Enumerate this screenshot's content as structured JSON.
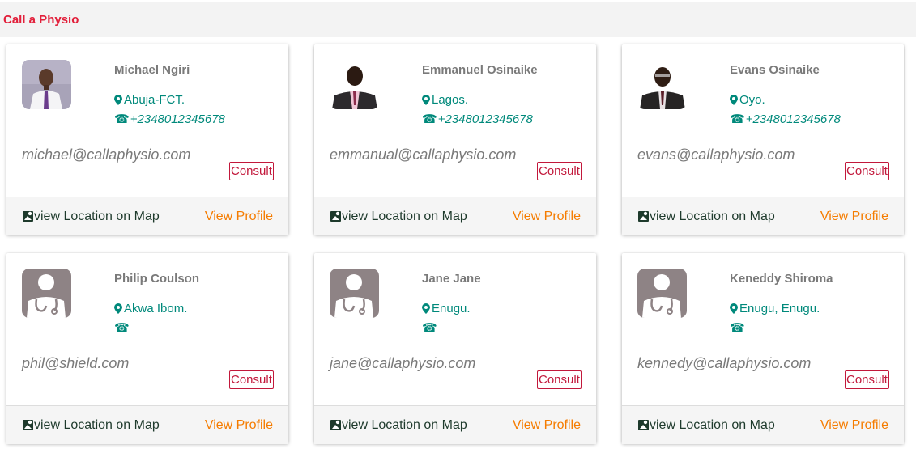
{
  "header": {
    "brand": "Call a Physio"
  },
  "cards": [
    {
      "name": "Michael Ngiri",
      "location": "Abuja-FCT.",
      "phone": "+2348012345678",
      "email": "michael@callaphysio.com",
      "avatar": "photo-1",
      "consult_label": "Consult",
      "map_label": "view Location on Map",
      "profile_label": "View Profile"
    },
    {
      "name": "Emmanuel Osinaike",
      "location": "Lagos.",
      "phone": "+2348012345678",
      "email": "emmanual@callaphysio.com",
      "avatar": "photo-2",
      "consult_label": "Consult",
      "map_label": "view Location on Map",
      "profile_label": "View Profile"
    },
    {
      "name": "Evans Osinaike",
      "location": "Oyo.",
      "phone": "+2348012345678",
      "email": "evans@callaphysio.com",
      "avatar": "photo-3",
      "consult_label": "Consult",
      "map_label": "view Location on Map",
      "profile_label": "View Profile"
    },
    {
      "name": "Philip Coulson",
      "location": "Akwa Ibom.",
      "phone": "",
      "email": "phil@shield.com",
      "avatar": "doctor-placeholder",
      "consult_label": "Consult",
      "map_label": "view Location on Map",
      "profile_label": "View Profile"
    },
    {
      "name": "Jane Jane",
      "location": "Enugu.",
      "phone": "",
      "email": "jane@callaphysio.com",
      "avatar": "doctor-placeholder",
      "consult_label": "Consult",
      "map_label": "view Location on Map",
      "profile_label": "View Profile"
    },
    {
      "name": "Keneddy Shiroma",
      "location": "Enugu, Enugu.",
      "phone": "",
      "email": "kennedy@callaphysio.com",
      "avatar": "doctor-placeholder",
      "consult_label": "Consult",
      "map_label": "view Location on Map",
      "profile_label": "View Profile"
    }
  ],
  "icons": {
    "location": "map-pin-icon",
    "phone": "telephone-icon",
    "map": "map-icon"
  },
  "colors": {
    "brand": "#e2203b",
    "accent_teal": "#00897b",
    "consult": "#c2183b",
    "profile_link": "#f57c00",
    "map_link": "#1e3a2c",
    "muted_text": "#7a7a7a"
  }
}
